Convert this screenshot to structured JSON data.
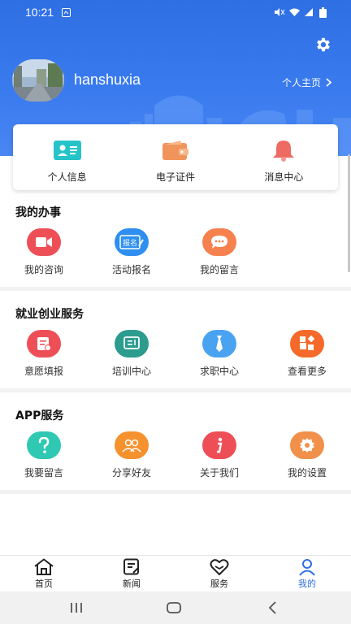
{
  "status_bar": {
    "time": "10:21"
  },
  "profile": {
    "username": "hanshuxia",
    "profile_link": "个人主页"
  },
  "quick": [
    {
      "label": "个人信息",
      "icon": "id-card-icon",
      "color": "#26c4c8"
    },
    {
      "label": "电子证件",
      "icon": "wallet-icon",
      "color": "#f0945c"
    },
    {
      "label": "消息中心",
      "icon": "bell-icon",
      "color": "#ee6b64"
    }
  ],
  "sections": [
    {
      "title": "我的办事",
      "items": [
        {
          "label": "我的咨询",
          "icon": "video-icon",
          "color": "#ee4f57"
        },
        {
          "label": "活动报名",
          "icon": "signup-icon",
          "color": "#2e8ff0",
          "badge": "报名"
        },
        {
          "label": "我的留言",
          "icon": "chat-bubble-icon",
          "color": "#f5814f"
        }
      ]
    },
    {
      "title": "就业创业服务",
      "items": [
        {
          "label": "意愿填报",
          "icon": "form-icon",
          "color": "#ee4f57"
        },
        {
          "label": "培训中心",
          "icon": "training-icon",
          "color": "#2b9c8e"
        },
        {
          "label": "求职中心",
          "icon": "tie-icon",
          "color": "#4aa3f0"
        },
        {
          "label": "查看更多",
          "icon": "more-grid-icon",
          "color": "#f56a2a"
        }
      ]
    },
    {
      "title": "APP服务",
      "items": [
        {
          "label": "我要留言",
          "icon": "question-icon",
          "color": "#2fc8b2"
        },
        {
          "label": "分享好友",
          "icon": "friends-icon",
          "color": "#f5922e"
        },
        {
          "label": "关于我们",
          "icon": "info-icon",
          "color": "#ee4f57"
        },
        {
          "label": "我的设置",
          "icon": "settings-icon",
          "color": "#f0904a"
        }
      ]
    }
  ],
  "tabs": [
    {
      "label": "首页",
      "icon": "home-icon",
      "active": false
    },
    {
      "label": "新闻",
      "icon": "news-icon",
      "active": false
    },
    {
      "label": "服务",
      "icon": "heart-icon",
      "active": false
    },
    {
      "label": "我的",
      "icon": "user-icon",
      "active": true
    }
  ],
  "colors": {
    "primary": "#2f6fe4",
    "active_tab": "#2f6fe4"
  }
}
